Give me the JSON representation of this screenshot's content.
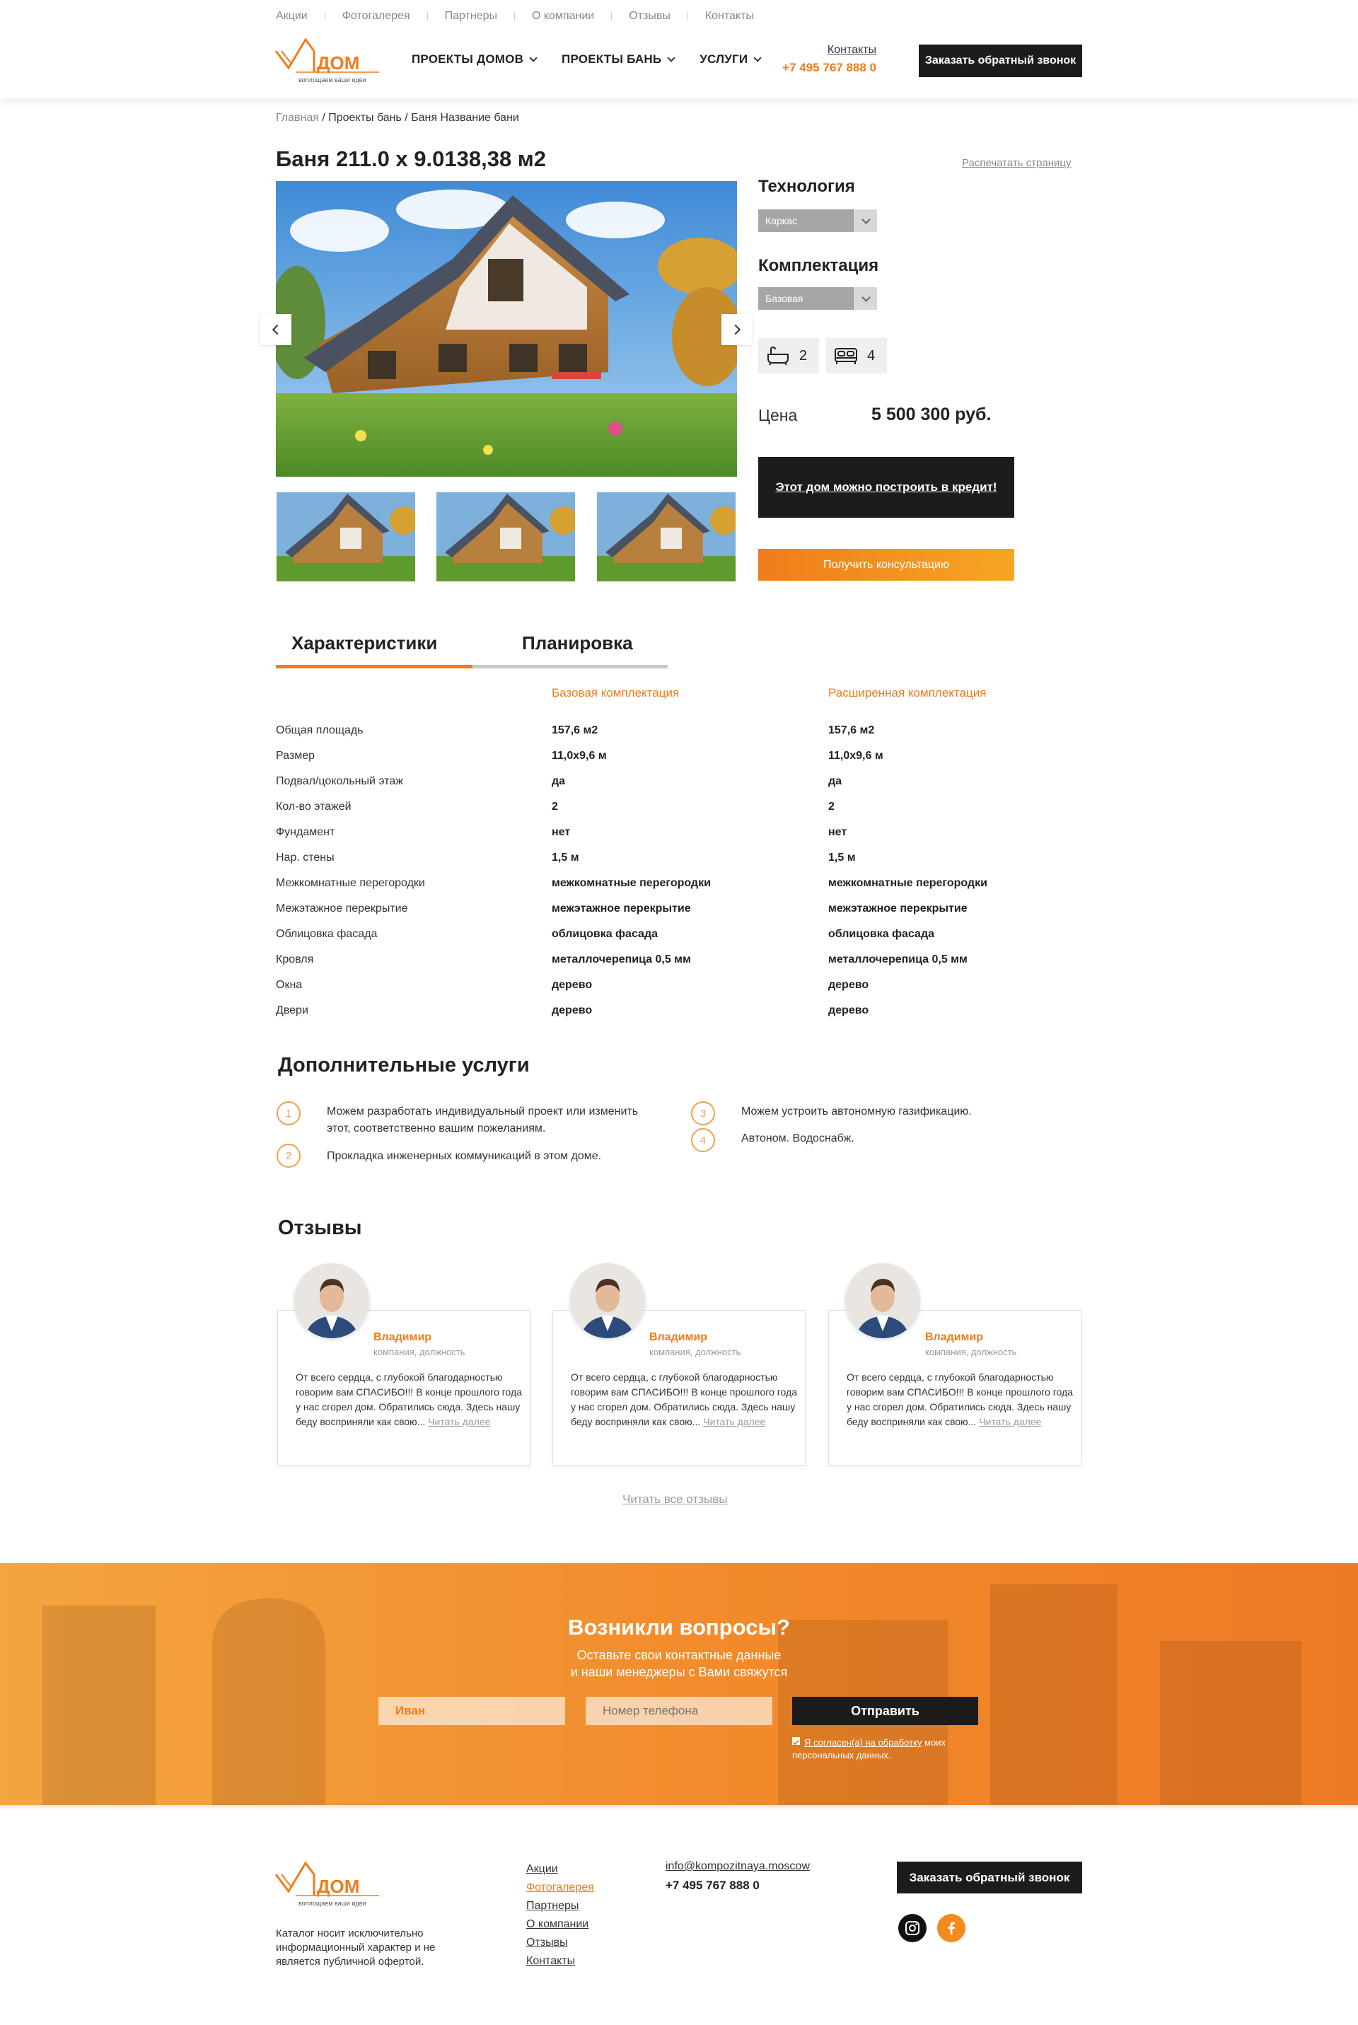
{
  "topnav": [
    "Акции",
    "Фотогалерея",
    "Партнеры",
    "О компании",
    "Отзывы",
    "Контакты"
  ],
  "logo": {
    "text": "ДОМ",
    "tagline": "воплощаем ваши идеи"
  },
  "mainnav": [
    "Проекты домов",
    "Проекты бань",
    "Услуги"
  ],
  "header": {
    "contacts_link": "Контакты",
    "phone": "+7 495 767 888 0",
    "callback": "Заказать обратный звонок"
  },
  "breadcrumb": {
    "home": "Главная",
    "rest": " / Проекты бань / Баня Название бани"
  },
  "title": "Баня 211.0 x 9.0138,38 м2",
  "print": "Распечатать страницу",
  "options": {
    "tech_title": "Технология",
    "tech_value": "Каркас",
    "kit_title": "Комплектация",
    "kit_value": "Базовая"
  },
  "features": {
    "baths": "2",
    "beds": "4"
  },
  "price": {
    "label": "Цена",
    "value": "5 500 300 руб."
  },
  "credit": "Этот дом можно построить в кредит!",
  "consult": "Получить консультацию",
  "tabs": [
    "Характеристики",
    "Планировка"
  ],
  "specs": {
    "col1": "Базовая комплектация",
    "col2": "Расширенная комплектация",
    "rows": [
      [
        "Общая площадь",
        "157,6 м2",
        "157,6 м2"
      ],
      [
        "Размер",
        "11,0х9,6 м",
        "11,0х9,6 м"
      ],
      [
        "Подвал/цокольный этаж",
        "да",
        "да"
      ],
      [
        "Кол-во этажей",
        "2",
        "2"
      ],
      [
        "Фундамент",
        "нет",
        "нет"
      ],
      [
        "Нар. стены",
        "1,5 м",
        "1,5 м"
      ],
      [
        "Межкомнатные перегородки",
        "межкомнатные перегородки",
        "межкомнатные перегородки"
      ],
      [
        "Межэтажное перекрытие",
        "межэтажное перекрытие",
        "межэтажное перекрытие"
      ],
      [
        "Облицовка фасада",
        "облицовка фасада",
        "облицовка фасада"
      ],
      [
        "Кровля",
        "металлочерепица 0,5 мм",
        "металлочерепица 0,5 мм"
      ],
      [
        "Окна",
        "дерево",
        "дерево"
      ],
      [
        "Двери",
        "дерево",
        "дерево"
      ]
    ]
  },
  "services": {
    "title": "Дополнительные услуги",
    "items": [
      {
        "n": "1",
        "text": "Можем разработать индивидуальный проект или изменить этот, соответственно вашим пожеланиям."
      },
      {
        "n": "2",
        "text": "Прокладка инженерных коммуникаций в этом доме."
      },
      {
        "n": "3",
        "text": "Можем устроить автономную газификацию."
      },
      {
        "n": "4",
        "text": "Автоном. Водоснабж."
      }
    ]
  },
  "reviews": {
    "title": "Отзывы",
    "items": [
      {
        "name": "Владимир",
        "position": "компания, должность",
        "text": "От всего сердца, с глубокой благодарностью говорим вам СПАСИБО!!! В конце прошлого года у нас сгорел дом. Обратились сюда. Здесь нашу беду восприняли как свою...",
        "more": "Читать далее"
      },
      {
        "name": "Владимир",
        "position": "компания, должность",
        "text": "От всего сердца, с глубокой благодарностью говорим вам СПАСИБО!!! В конце прошлого года у нас сгорел дом. Обратились сюда. Здесь нашу беду восприняли как свою...",
        "more": "Читать далее"
      },
      {
        "name": "Владимир",
        "position": "компания, должность",
        "text": "От всего сердца, с глубокой благодарностью говорим вам СПАСИБО!!! В конце прошлого года у нас сгорел дом. Обратились сюда. Здесь нашу беду восприняли как свою...",
        "more": "Читать далее"
      }
    ],
    "all": "Читать все отзывы"
  },
  "contact_form": {
    "title": "Возникли вопросы?",
    "subtitle_1": "Оставьте свои контактные данные",
    "subtitle_2": "и наши менеджеры с Вами свяжутся",
    "name_value": "Иван",
    "phone_placeholder": "Номер телефона",
    "send": "Отправить",
    "agree_link": "Я согласен(а) на обработку",
    "agree_rest": " моих персональных данных."
  },
  "footer": {
    "note": "Каталог носит исключительно информационный характер и не является публичной офертой.",
    "links": [
      "Акции",
      "Фотогалерея",
      "Партнеры",
      "О компании",
      "Отзывы",
      "Контакты"
    ],
    "email": "info@kompozitnaya.moscow",
    "phone": "+7 495 767 888 0",
    "callback": "Заказать обратный звонок"
  },
  "colors": {
    "accent": "#f07c1b",
    "dark": "#1c1c1c",
    "gray": "#a6a6a6"
  }
}
